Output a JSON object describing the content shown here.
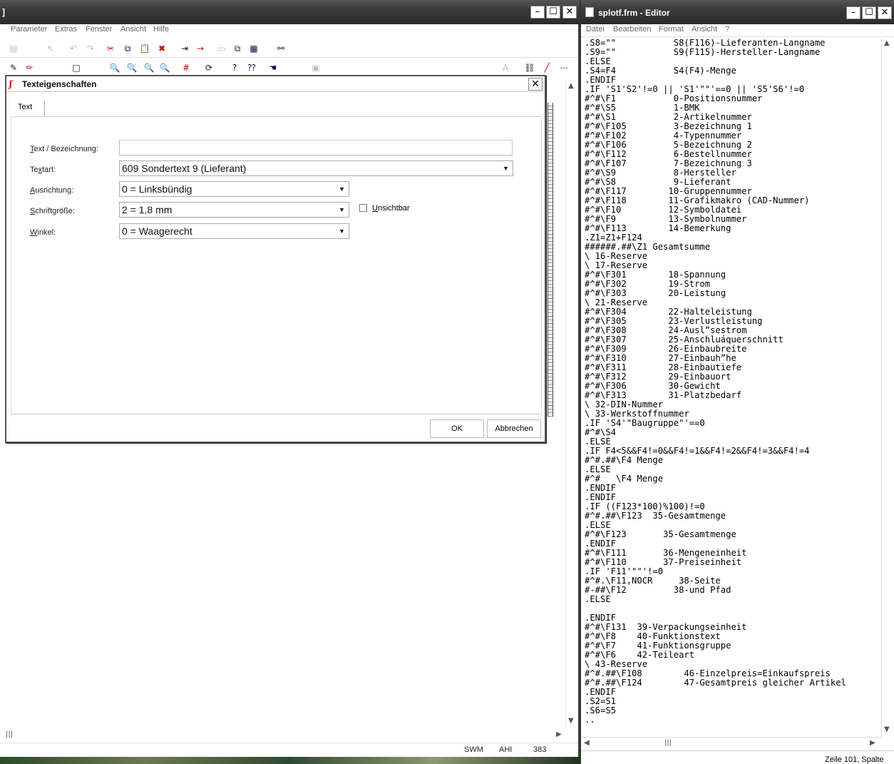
{
  "left_window": {
    "title": "]",
    "menu": [
      "Parameter",
      "Extras",
      "Fenster",
      "Ansicht",
      "Hilfe"
    ],
    "status": {
      "cell1": "SWM",
      "cell2": "AHI",
      "cell3": "383"
    }
  },
  "dialog": {
    "title": "Texteigenschaften",
    "tab": "Text",
    "fields": {
      "bezeichnung": {
        "label_pre": "",
        "label_u": "T",
        "label_post": "ext / Bezeichnung:",
        "value": ""
      },
      "textart": {
        "label_pre": "Te",
        "label_u": "x",
        "label_post": "tart:",
        "value": "609 Sondertext 9 (Lieferant)"
      },
      "ausrichtung": {
        "label_pre": "",
        "label_u": "A",
        "label_post": "usrichtung:",
        "value": "0 = Linksbündig"
      },
      "schriftgroesse": {
        "label_pre": "",
        "label_u": "S",
        "label_post": "chriftgröße:",
        "value": "2 = 1,8 mm"
      },
      "winkel": {
        "label_pre": "",
        "label_u": "W",
        "label_post": "inkel:",
        "value": "0 = Waagerecht"
      }
    },
    "checkbox_unsichtbar": {
      "label_u": "U",
      "label_post": "nsichtbar",
      "checked": false
    },
    "ok_label": "OK",
    "cancel_label": "Abbrechen"
  },
  "editor": {
    "title": "splotf.frm - Editor",
    "menu": [
      "Datei",
      "Bearbeiten",
      "Format",
      "Ansicht",
      "?"
    ],
    "lines": [
      ".S8=\"\"           S8(F116)-Lieferanten-Langname",
      ".S9=\"\"           S9(F115)-Hersteller-Langname",
      ".ELSE",
      ".S4=F4           S4(F4)-Menge",
      ".ENDIF",
      ".IF 'S1'S2'!=0 || 'S1'\"\"'==0 || 'S5'S6'!=0",
      "#^#\\F1           0-Positionsnummer",
      "#^#\\S5           1-BMK",
      "#^#\\S1           2-Artikelnummer",
      "#^#\\F105         3-Bezeichnung 1",
      "#^#\\F102         4-Typennummer",
      "#^#\\F106         5-Bezeichnung 2",
      "#^#\\F112         6-Bestellnummer",
      "#^#\\F107         7-Bezeichnung 3",
      "#^#\\S9           8-Hersteller",
      "#^#\\S8           9-Lieferant",
      "#^#\\F117        10-Gruppennummer",
      "#^#\\F118        11-Grafikmakro (CAD-Nummer)",
      "#^#\\F10         12-Symboldatei",
      "#^#\\F9          13-Symbolnummer",
      "#^#\\F113        14-Bemerkung",
      ".Z1=Z1+F124",
      "######.##\\Z1 Gesamtsumme",
      "\\ 16-Reserve",
      "\\ 17-Reserve",
      "#^#\\F301        18-Spannung",
      "#^#\\F302        19-Strom",
      "#^#\\F303        20-Leistung",
      "\\ 21-Reserve",
      "#^#\\F304        22-Halteleistung",
      "#^#\\F305        23-Verlustleistung",
      "#^#\\F308        24-Ausl”sestrom",
      "#^#\\F307        25-Anschluáquerschnitt",
      "#^#\\F309        26-Einbaubreite",
      "#^#\\F310        27-Einbauh”he",
      "#^#\\F311        28-Einbautiefe",
      "#^#\\F312        29-Einbauort",
      "#^#\\F306        30-Gewicht",
      "#^#\\F313        31-Platzbedarf",
      "\\ 32-DIN-Nummer",
      "\\ 33-Werkstoffnummer",
      ".IF 'S4'\"Baugruppe\"'==0",
      "#^#\\S4",
      ".ELSE",
      ".IF F4<5&&F4!=0&&F4!=1&&F4!=2&&F4!=3&&F4!=4",
      "#^#.##\\F4 Menge",
      ".ELSE",
      "#^#   \\F4 Menge",
      ".ENDIF",
      ".ENDIF",
      ".IF ((F123*100)%100)!=0",
      "#^#.##\\F123  35-Gesamtmenge",
      ".ELSE",
      "#^#\\F123       35-Gesamtmenge",
      ".ENDIF",
      "#^#\\F111       36-Mengeneinheit",
      "#^#\\F110       37-Preiseinheit",
      ".IF 'F11'\"\"'!=0",
      "#^#.\\F11,NOCR     38-Seite",
      "#-##\\F12         38-und Pfad",
      ".ELSE",
      "",
      ".ENDIF",
      "#^#\\F131  39-Verpackungseinheit",
      "#^#\\F8    40-Funktionstext",
      "#^#\\F7    41-Funktionsgruppe",
      "#^#\\F6    42-Teileart",
      "\\ 43-Reserve",
      "#^#.##\\F108        46-Einzelpreis=Einkaufspreis",
      "#^#.##\\F124        47-Gesamtpreis gleicher Artikel",
      ".ENDIF",
      ".S2=S1",
      ".S6=S5",
      ".."
    ],
    "status": "Zeile 101, Spalte"
  }
}
